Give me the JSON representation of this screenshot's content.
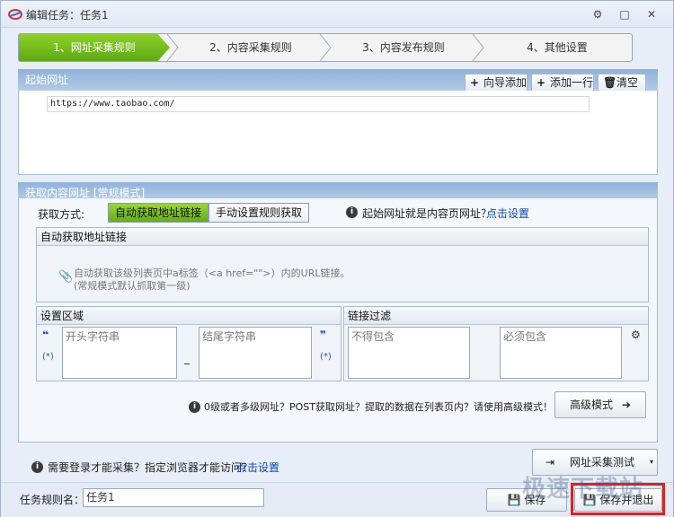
{
  "window": {
    "title": "编辑任务：任务1",
    "controls": [
      "⚙",
      "□",
      "✕"
    ]
  },
  "steps": [
    {
      "label": "1、网址采集规则",
      "active": true
    },
    {
      "label": "2、内容采集规则",
      "active": false
    },
    {
      "label": "3、内容发布规则",
      "active": false
    },
    {
      "label": "4、其他设置",
      "active": false
    }
  ],
  "start_url": {
    "section_title": "起始网址",
    "buttons": {
      "wizard_add": "向导添加",
      "add_row": "添加一行",
      "clear": "清空"
    },
    "value": "https://www.taobao.com/"
  },
  "content_url": {
    "section_title": "获取内容网址 [常规模式]",
    "method_label": "获取方式:",
    "method_auto": "自动获取地址链接",
    "method_manual": "手动设置规则获取",
    "question": "起始网址就是内容页网址？",
    "question_link": "点击设置",
    "auto_panel_title": "自动获取地址链接",
    "auto_desc_line1": "自动获取该级列表页中a标签（<a href=\"\">）内的URL链接。",
    "auto_desc_line2": "(常规模式默认抓取第一级)",
    "settings_title": "设置区域",
    "start_placeholder": "开头字符串",
    "end_placeholder": "结尾字符串",
    "open_quote": "❝",
    "close_quote": "❞",
    "wildcard": "(*)",
    "dash": "_",
    "filter_title": "链接过滤",
    "exclude_placeholder": "不得包含",
    "include_placeholder": "必须包含",
    "advanced_hint": "0级或者多级网址？POST获取网址？提取的数据在列表页内？请使用高级模式！",
    "advanced_button": "高级模式"
  },
  "bottom": {
    "login_hint": "需要登录才能采集？指定浏览器才能访问？",
    "login_link": "点击设置",
    "test_button": "网址采集测试",
    "rule_name_label": "任务规则名：",
    "rule_name_value": "任务1",
    "save_button": "保存",
    "save_exit_button": "保存并退出"
  },
  "watermark": "极速下载站",
  "colors": {
    "accent_green": "#6fbf1d",
    "band_blue": "#9dbbe0",
    "link": "#0b47b8",
    "highlight_red": "#e02020"
  }
}
